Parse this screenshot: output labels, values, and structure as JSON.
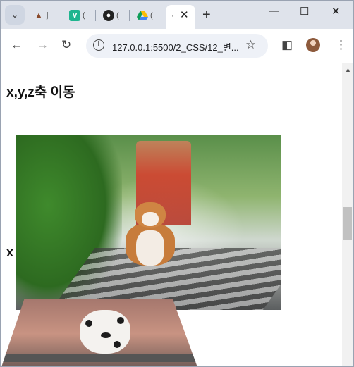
{
  "browser": {
    "tabs": [
      {
        "title": "j",
        "icon": "volcano-icon"
      },
      {
        "title": "(",
        "icon": "v-logo-icon"
      },
      {
        "title": "(",
        "icon": "github-icon"
      },
      {
        "title": "(",
        "icon": "google-drive-icon"
      }
    ],
    "active_tab_title": "·",
    "new_tab_label": "+",
    "url": "127.0.0.1:5500/2_CSS/12_변..."
  },
  "page": {
    "heading": "x,y,z축 이동",
    "label_x": "x"
  },
  "colors": {
    "accent": "#dfe3eb",
    "tab_v_logo": "#1fb58f",
    "google_drive_blue": "#4285f4"
  }
}
